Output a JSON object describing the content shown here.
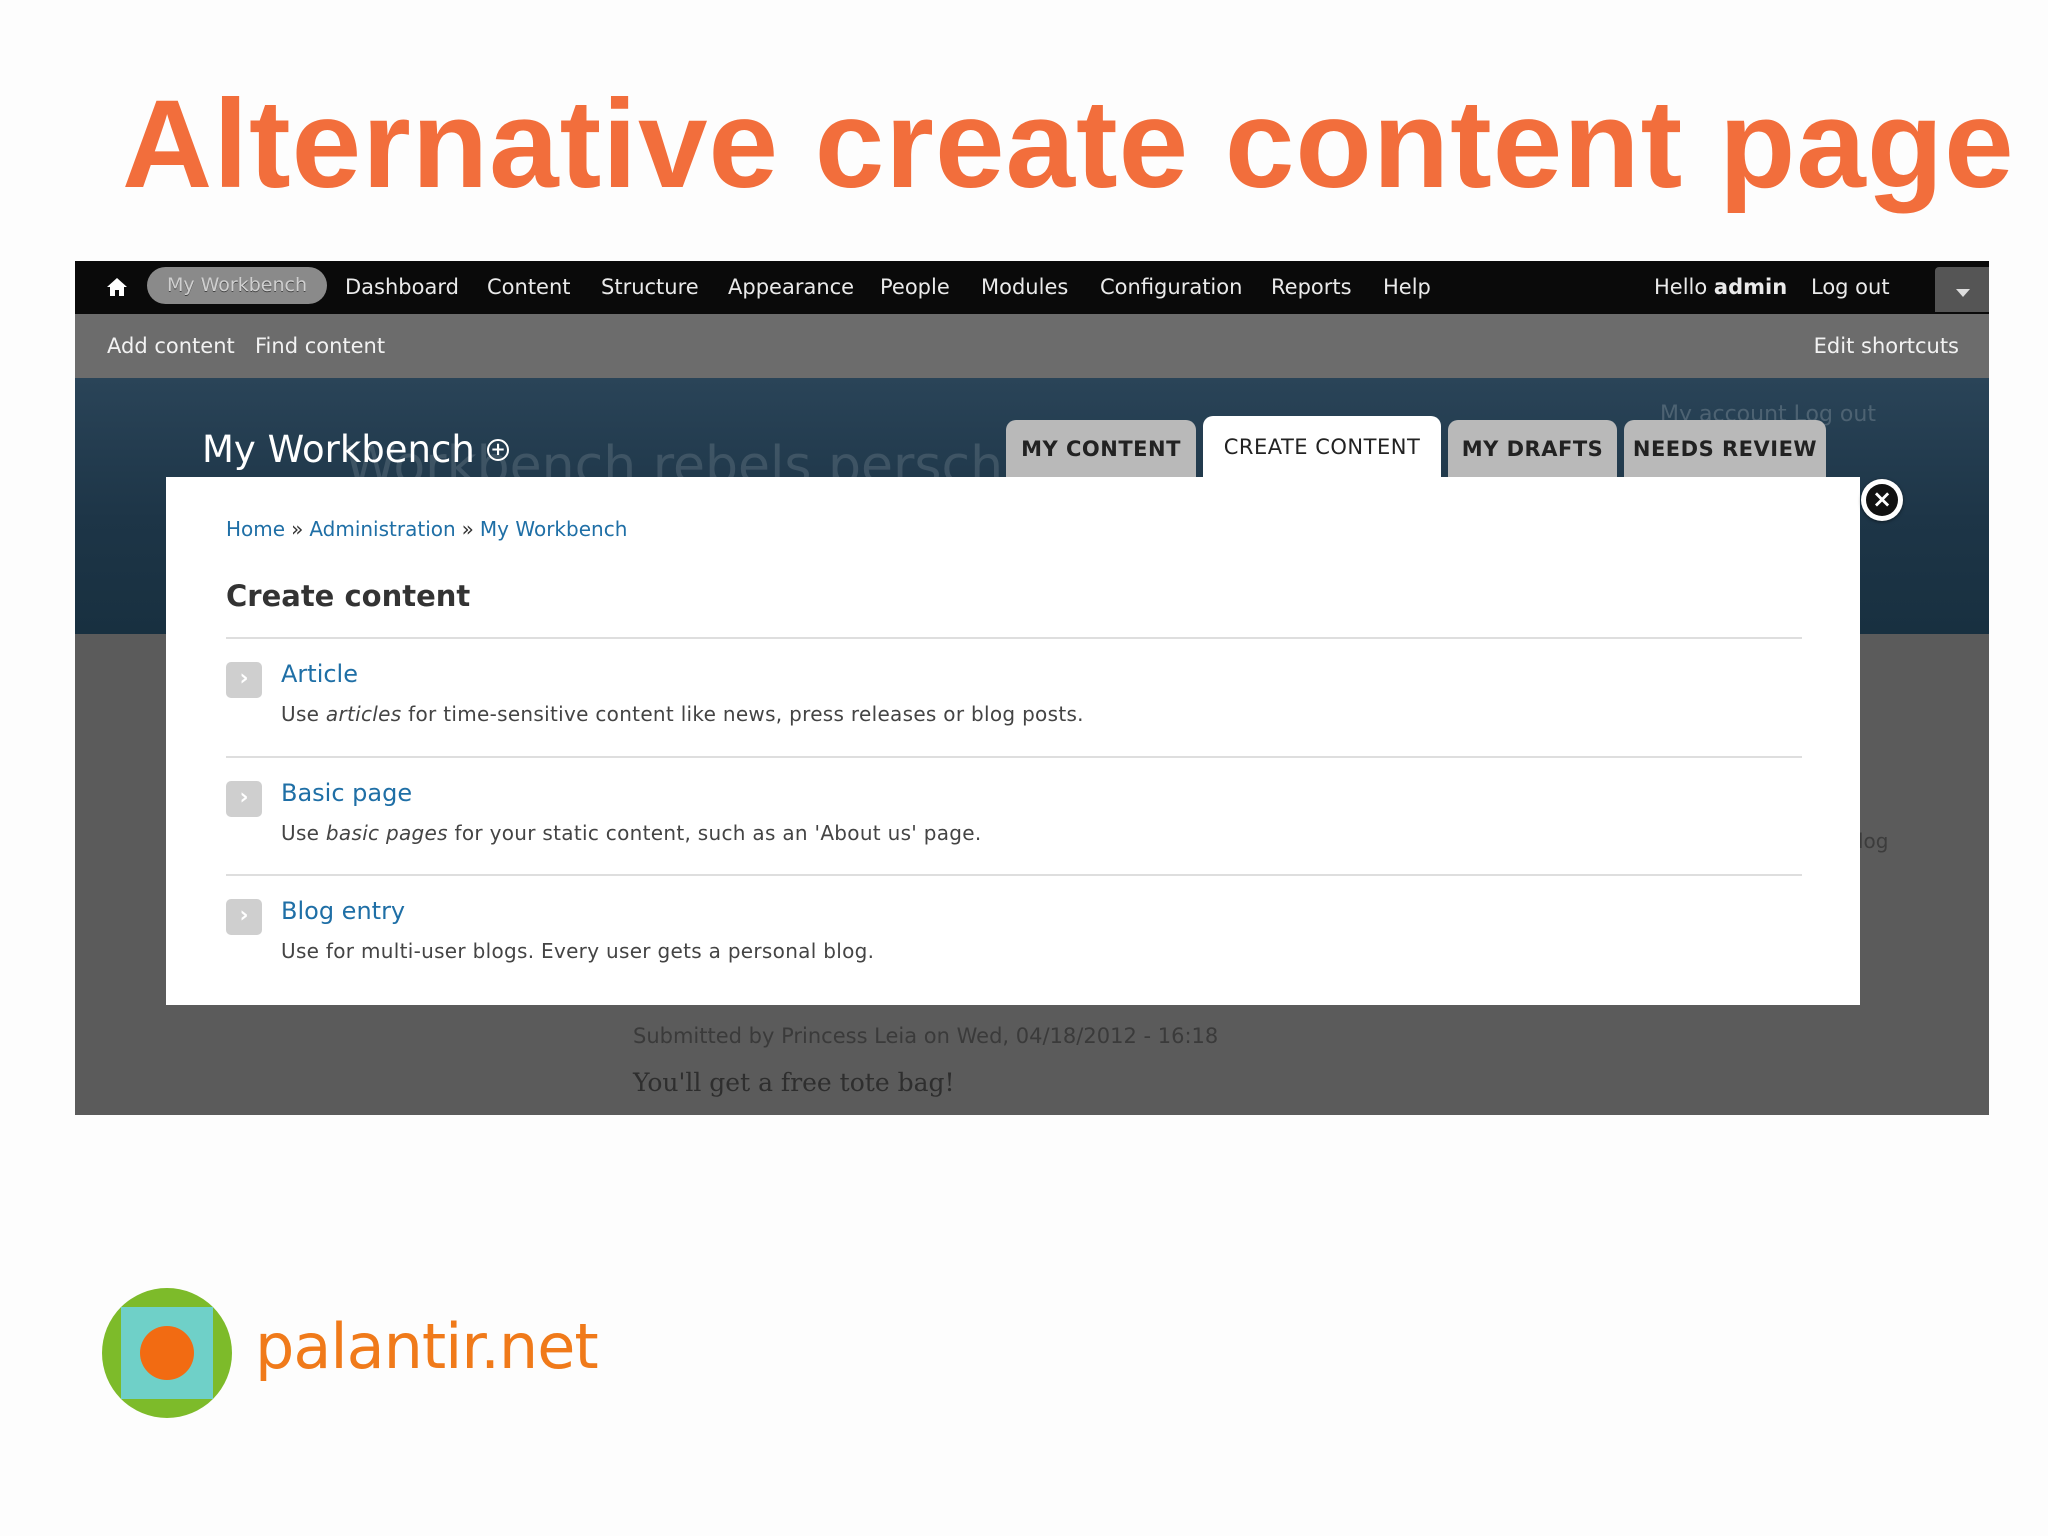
{
  "slide": {
    "title": "Alternative create content page",
    "brand": "palantir.net"
  },
  "toolbar": {
    "active_item": "My Workbench",
    "items": [
      "Dashboard",
      "Content",
      "Structure",
      "Appearance",
      "People",
      "Modules",
      "Configuration",
      "Reports",
      "Help"
    ],
    "hello": "Hello",
    "user": "admin",
    "logout": "Log out"
  },
  "shortcuts": {
    "add_content": "Add content",
    "find_content": "Find content",
    "edit_shortcuts": "Edit shortcuts"
  },
  "header": {
    "title": "My Workbench",
    "background_site_name": "Workbench rebels persch sand",
    "background_links": "My account   Log out",
    "tabs": [
      {
        "label": "MY CONTENT",
        "active": false
      },
      {
        "label": "CREATE CONTENT",
        "active": true
      },
      {
        "label": "MY DRAFTS",
        "active": false
      },
      {
        "label": "NEEDS REVIEW",
        "active": false
      }
    ]
  },
  "background": {
    "submitted": "Submitted by Princess Leia on Wed, 04/18/2012 - 16:18",
    "body": "You'll get a free tote bag!",
    "side_link": "log"
  },
  "modal": {
    "breadcrumb": [
      "Home",
      "Administration",
      "My Workbench"
    ],
    "breadcrumb_sep": "»",
    "title": "Create content",
    "entries": [
      {
        "name": "Article",
        "desc_pre": "Use ",
        "desc_em": "articles",
        "desc_post": " for time-sensitive content like news, press releases or blog posts."
      },
      {
        "name": "Basic page",
        "desc_pre": "Use ",
        "desc_em": "basic pages",
        "desc_post": " for your static content, such as an 'About us' page."
      },
      {
        "name": "Blog entry",
        "desc_pre": "Use for multi-user blogs. Every user gets a personal blog.",
        "desc_em": "",
        "desc_post": ""
      }
    ]
  },
  "colors": {
    "title_orange": "#f26e3c",
    "link_blue": "#1f6fa6",
    "toolbar_black": "#0a0a0a",
    "logo_green": "#7dbb2a",
    "logo_teal": "#6fd0c8",
    "logo_orange": "#f26b12"
  }
}
